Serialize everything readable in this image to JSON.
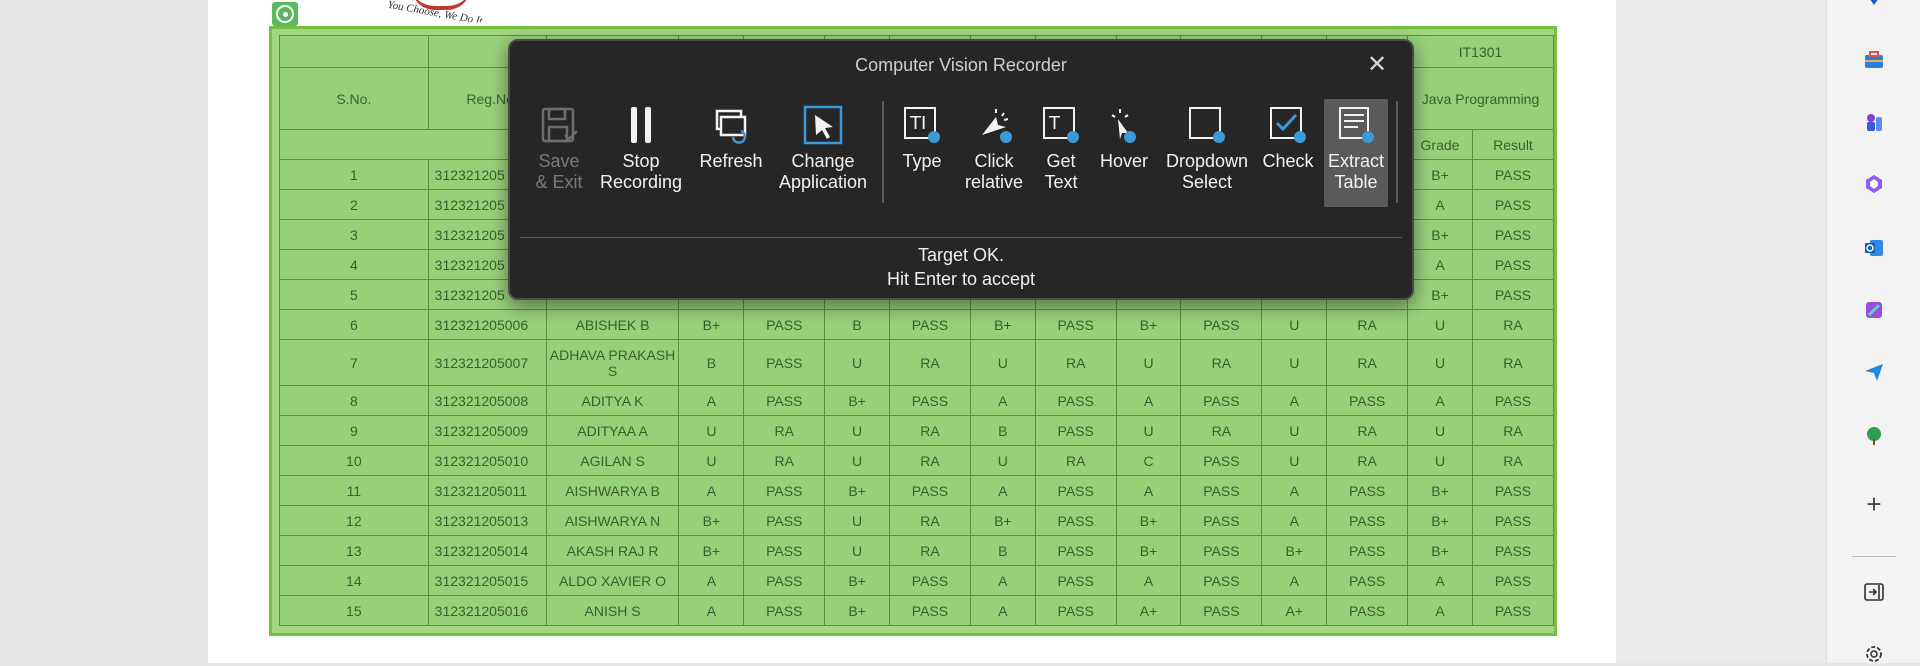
{
  "logo": {
    "tagline": "You Choose, We Do It"
  },
  "recorder": {
    "title": "Computer Vision Recorder",
    "tools": [
      {
        "id": "save-exit",
        "line1": "Save",
        "line2": "& Exit",
        "icon": "save-exit-icon",
        "state": "disabled"
      },
      {
        "id": "stop-recording",
        "line1": "Stop",
        "line2": "Recording",
        "icon": "pause-icon",
        "state": "normal"
      },
      {
        "id": "refresh",
        "line1": "Refresh",
        "line2": "",
        "icon": "refresh-icon",
        "state": "normal"
      },
      {
        "id": "change-application",
        "line1": "Change",
        "line2": "Application",
        "icon": "cursor-select-icon",
        "state": "normal"
      },
      {
        "id": "type",
        "line1": "Type",
        "line2": "",
        "icon": "type-text-icon",
        "state": "normal"
      },
      {
        "id": "click-relative",
        "line1": "Click",
        "line2": "relative",
        "icon": "click-relative-icon",
        "state": "normal"
      },
      {
        "id": "get-text",
        "line1": "Get",
        "line2": "Text",
        "icon": "get-text-icon",
        "state": "normal"
      },
      {
        "id": "hover",
        "line1": "Hover",
        "line2": "",
        "icon": "hover-icon",
        "state": "normal"
      },
      {
        "id": "dropdown-select",
        "line1": "Dropdown",
        "line2": "Select",
        "icon": "dropdown-select-icon",
        "state": "normal"
      },
      {
        "id": "check",
        "line1": "Check",
        "line2": "",
        "icon": "checkbox-icon",
        "state": "normal"
      },
      {
        "id": "extract-table",
        "line1": "Extract",
        "line2": "Table",
        "icon": "extract-table-icon",
        "state": "active"
      }
    ],
    "status_line1": "Target OK.",
    "status_line2": "Hit Enter to accept"
  },
  "table": {
    "course_code": "IT1301",
    "course_name": "Java Programming",
    "header_sno": "S.No.",
    "header_reg": "Reg.No",
    "header_grade": "Grade",
    "header_result": "Result",
    "rows": [
      {
        "sno": "1",
        "reg": "312321205",
        "name": "",
        "g": [
          "",
          "",
          "",
          "",
          "",
          "B+"
        ],
        "r": [
          "",
          "",
          "",
          "",
          "",
          "PASS"
        ]
      },
      {
        "sno": "2",
        "reg": "312321205",
        "name": "",
        "g": [
          "",
          "",
          "",
          "",
          "",
          "A"
        ],
        "r": [
          "",
          "",
          "",
          "",
          "",
          "PASS"
        ]
      },
      {
        "sno": "3",
        "reg": "312321205",
        "name": "",
        "g": [
          "",
          "",
          "",
          "",
          "",
          "B+"
        ],
        "r": [
          "",
          "",
          "",
          "",
          "",
          "PASS"
        ]
      },
      {
        "sno": "4",
        "reg": "312321205",
        "name": "",
        "g": [
          "",
          "",
          "",
          "",
          "",
          "A"
        ],
        "r": [
          "",
          "",
          "",
          "",
          "",
          "PASS"
        ]
      },
      {
        "sno": "5",
        "reg": "312321205",
        "name": "",
        "g": [
          "",
          "",
          "",
          "",
          "",
          "B+"
        ],
        "r": [
          "",
          "",
          "",
          "",
          "",
          "PASS"
        ]
      },
      {
        "sno": "6",
        "reg": "312321205006",
        "name": "ABISHEK B",
        "g": [
          "B+",
          "B",
          "B+",
          "B+",
          "U",
          "U"
        ],
        "r": [
          "PASS",
          "PASS",
          "PASS",
          "PASS",
          "RA",
          "RA"
        ]
      },
      {
        "sno": "7",
        "reg": "312321205007",
        "name": "ADHAVA PRAKASH S",
        "g": [
          "B",
          "U",
          "U",
          "U",
          "U",
          "U"
        ],
        "r": [
          "PASS",
          "RA",
          "RA",
          "RA",
          "RA",
          "RA"
        ]
      },
      {
        "sno": "8",
        "reg": "312321205008",
        "name": "ADITYA K",
        "g": [
          "A",
          "B+",
          "A",
          "A",
          "A",
          "A"
        ],
        "r": [
          "PASS",
          "PASS",
          "PASS",
          "PASS",
          "PASS",
          "PASS"
        ]
      },
      {
        "sno": "9",
        "reg": "312321205009",
        "name": "ADITYAA A",
        "g": [
          "U",
          "U",
          "B",
          "U",
          "U",
          "U"
        ],
        "r": [
          "RA",
          "RA",
          "PASS",
          "RA",
          "RA",
          "RA"
        ]
      },
      {
        "sno": "10",
        "reg": "312321205010",
        "name": "AGILAN S",
        "g": [
          "U",
          "U",
          "U",
          "C",
          "U",
          "U"
        ],
        "r": [
          "RA",
          "RA",
          "RA",
          "PASS",
          "RA",
          "RA"
        ]
      },
      {
        "sno": "11",
        "reg": "312321205011",
        "name": "AISHWARYA B",
        "g": [
          "A",
          "B+",
          "A",
          "A",
          "A",
          "B+"
        ],
        "r": [
          "PASS",
          "PASS",
          "PASS",
          "PASS",
          "PASS",
          "PASS"
        ]
      },
      {
        "sno": "12",
        "reg": "312321205013",
        "name": "AISHWARYA N",
        "g": [
          "B+",
          "U",
          "B+",
          "B+",
          "A",
          "B+"
        ],
        "r": [
          "PASS",
          "RA",
          "PASS",
          "PASS",
          "PASS",
          "PASS"
        ]
      },
      {
        "sno": "13",
        "reg": "312321205014",
        "name": "AKASH RAJ R",
        "g": [
          "B+",
          "U",
          "B",
          "B+",
          "B+",
          "B+"
        ],
        "r": [
          "PASS",
          "RA",
          "PASS",
          "PASS",
          "PASS",
          "PASS"
        ]
      },
      {
        "sno": "14",
        "reg": "312321205015",
        "name": "ALDO XAVIER O",
        "g": [
          "A",
          "B+",
          "A",
          "A",
          "A",
          "A"
        ],
        "r": [
          "PASS",
          "PASS",
          "PASS",
          "PASS",
          "PASS",
          "PASS"
        ]
      },
      {
        "sno": "15",
        "reg": "312321205016",
        "name": "ANISH S",
        "g": [
          "A",
          "B+",
          "A",
          "A+",
          "A+",
          "A"
        ],
        "r": [
          "PASS",
          "PASS",
          "PASS",
          "PASS",
          "PASS",
          "PASS"
        ]
      }
    ]
  },
  "sidebar": {
    "icons": [
      "favorites-icon",
      "toolbox-icon",
      "games-icon",
      "copilot-icon",
      "outlook-icon",
      "designer-icon",
      "send-icon",
      "tree-icon",
      "add-icon",
      "exit-panel-icon",
      "settings-icon"
    ]
  }
}
